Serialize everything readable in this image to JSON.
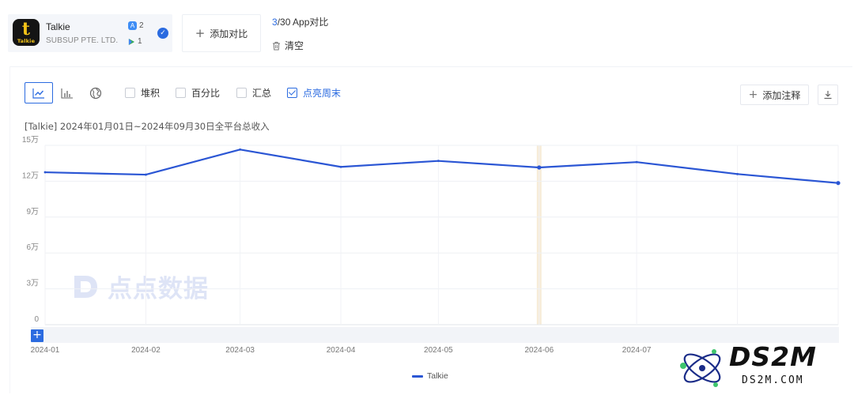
{
  "app": {
    "name": "Talkie",
    "company": "SUBSUP PTE. LTD.",
    "logo_text": "Talkie",
    "ios_count": "2",
    "gp_count": "1"
  },
  "compare": {
    "add_label": "添加对比",
    "count_current": "3",
    "count_rest": "/30 App对比",
    "clear_label": "清空"
  },
  "toolbar": {
    "options": {
      "stack": "堆积",
      "percent": "百分比",
      "summary": "汇总",
      "highlight_weekend": "点亮周末"
    },
    "add_note_label": "添加注释"
  },
  "watermark": {
    "text": "点点数据",
    "site_big": "DS2M",
    "site_small": "DS2M.COM"
  },
  "colors": {
    "accent": "#2b6be0",
    "series_line": "#2b56d4",
    "highlight_band": "#f7ecd8"
  },
  "chart_data": {
    "type": "line",
    "title": "[Talkie] 2024年01月01日~2024年09月30日全平台总收入",
    "x": [
      "2024-01-01",
      "2024-02-01",
      "2024-03-01",
      "2024-04-01",
      "2024-05-01",
      "2024-06-01",
      "2024-07-01",
      "2024-08-01",
      "2024-09-01"
    ],
    "x_tick_labels": [
      "2024-01",
      "2024-02",
      "2024-03",
      "2024-04",
      "2024-05",
      "2024-06",
      "2024-07"
    ],
    "series": [
      {
        "name": "Talkie",
        "values": [
          127500,
          125500,
          146500,
          132000,
          137000,
          131500,
          136000,
          126000,
          118500
        ]
      }
    ],
    "ylim": [
      0,
      150000
    ],
    "y_ticks": [
      0,
      30000,
      60000,
      90000,
      120000,
      150000
    ],
    "y_tick_labels": [
      "0",
      "3万",
      "6万",
      "9万",
      "12万",
      "15万"
    ],
    "highlight_x": "2024-06-01",
    "grid": true,
    "legend": "bottom-center"
  }
}
